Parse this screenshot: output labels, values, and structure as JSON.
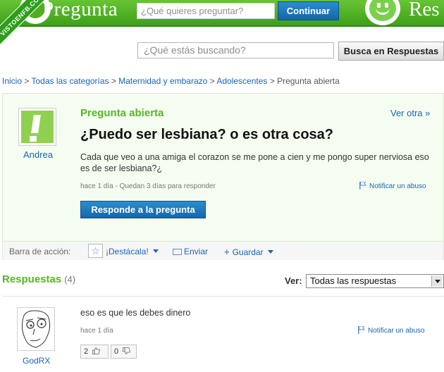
{
  "header": {
    "brand_left": "Pregunta",
    "search_placeholder": "¿Qué quieres preguntar?",
    "continue_label": "Continuar",
    "brand_right": "Res"
  },
  "watermark": "VISTOENFB.COM",
  "search": {
    "placeholder": "¿Qué estás buscando?",
    "button_label": "Busca en Respuestas"
  },
  "breadcrumb": [
    "Inicio",
    "Todas las categorías",
    "Maternidad y embarazo",
    "Adolescentes",
    "Pregunta abierta"
  ],
  "question": {
    "status_label": "Pregunta abierta",
    "other_link": "Ver otra »",
    "title": "¿Puedo ser lesbiana? o es otra cosa?",
    "body": "Cada que veo a una amiga el corazon se me pone a cien y me pongo super nerviosa eso es de ser lesbiana?¿",
    "meta": "hace 1 día - Quedan 3 días para responder",
    "report_label": "Notificar un abuso",
    "asker": "Andrea",
    "respond_button": "Responde a la pregunta"
  },
  "action_bar": {
    "label": "Barra de acción:",
    "destacala": "¡Destácala!",
    "enviar": "Enviar",
    "guardar": "Guardar"
  },
  "answers": {
    "heading": "Respuestas",
    "count": "(4)",
    "ver_label": "Ver:",
    "filter_value": "Todas las respuestas",
    "items": [
      {
        "author": "GodRX",
        "text": "eso es que les debes dinero",
        "meta": "hace 1 día",
        "report_label": "Notificar un abuso",
        "votes_up": "2",
        "votes_down": "0"
      }
    ]
  },
  "colors": {
    "green_brand": "#4fae22",
    "link_blue": "#1b63b5",
    "button_blue": "#1567aa",
    "panel_bg": "#f4fdf0"
  }
}
